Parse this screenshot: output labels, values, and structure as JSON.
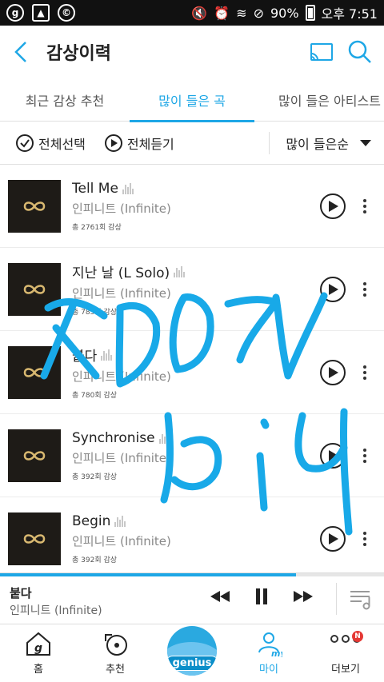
{
  "status_bar": {
    "battery": "90%",
    "time": "오후 7:51",
    "left_icons": [
      "g-app-icon",
      "image-icon",
      "copyright-icon"
    ]
  },
  "header": {
    "title": "감상이력"
  },
  "tabs": [
    {
      "label": "최근 감상 추천",
      "active": false
    },
    {
      "label": "많이 들은 곡",
      "active": true
    },
    {
      "label": "많이 들은 아티스트",
      "active": false
    }
  ],
  "toolbar": {
    "select_all": "전체선택",
    "play_all": "전체듣기",
    "sort": "많이 들은순"
  },
  "songs": [
    {
      "title": "Tell Me",
      "artist": "인피니트 (Infinite)",
      "count": "총 2761회 감상"
    },
    {
      "title": "지난 날 (L Solo)",
      "artist": "인피니트 (Infinite)",
      "count": "총 785회 감상"
    },
    {
      "title": "붙다",
      "artist": "인피니트 (Infinite)",
      "count": "총 780회 감상"
    },
    {
      "title": "Synchronise",
      "artist": "인피니트 (Infinite)",
      "count": "총 392회 감상"
    },
    {
      "title": "Begin",
      "artist": "인피니트 (Infinite)",
      "count": "총 392회 감상"
    }
  ],
  "mini_player": {
    "title": "붙다",
    "artist": "인피니트 (Infinite)",
    "progress": 0.77
  },
  "bottom_nav": [
    {
      "label": "홈",
      "icon": "home-icon"
    },
    {
      "label": "추천",
      "icon": "recommend-icon"
    },
    {
      "label": "genius",
      "icon": "genius-icon"
    },
    {
      "label": "마이",
      "icon": "my-icon",
      "active": true
    },
    {
      "label": "더보기",
      "icon": "more-icon",
      "badge": "N"
    }
  ],
  "colors": {
    "accent": "#1ea7e6",
    "album_bg": "#1e1b17",
    "album_logo": "#d8b870"
  }
}
